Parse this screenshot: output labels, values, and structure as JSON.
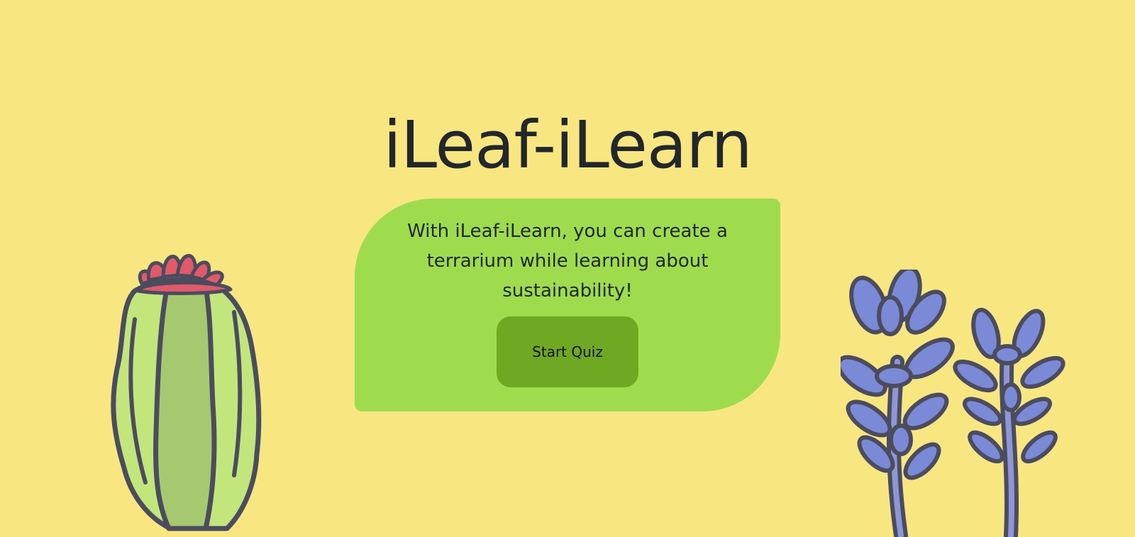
{
  "page": {
    "title": "iLeaf-iLearn",
    "description": "With iLeaf-iLearn, you can create a terrarium while learning about sustainability!",
    "start_button_label": "Start Quiz"
  },
  "colors": {
    "background": "#f8e681",
    "card": "#9edc4e",
    "button": "#6fa822",
    "text": "#22272b"
  },
  "illustrations": {
    "left": "cactus-icon",
    "right": "succulent-plants-icon"
  }
}
